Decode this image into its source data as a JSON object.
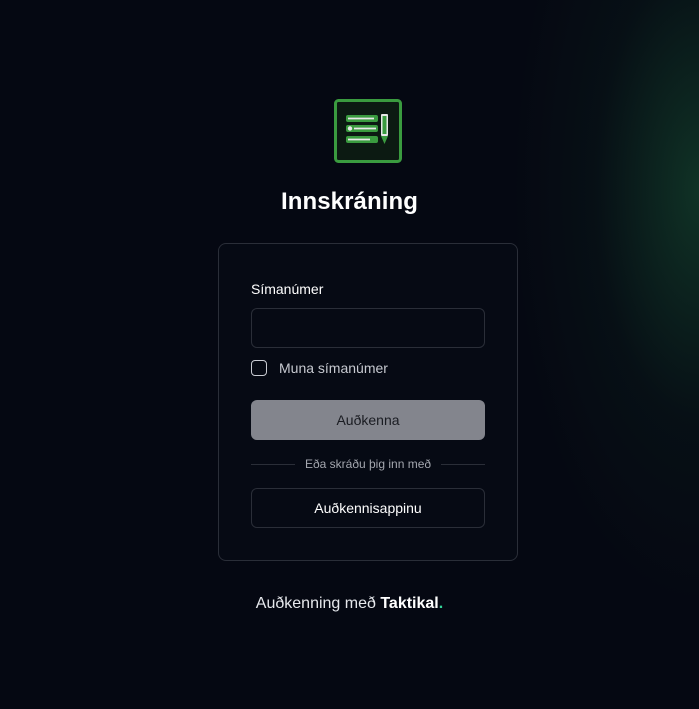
{
  "header": {
    "title": "Innskráning"
  },
  "form": {
    "phone_label": "Símanúmer",
    "phone_value": "",
    "remember_label": "Muna símanúmer",
    "remember_checked": false,
    "submit_label": "Auðkenna",
    "divider_text": "Eða skráðu þig inn með",
    "app_button_label": "Auðkennisappinu"
  },
  "footer": {
    "prefix": "Auðkenning með",
    "brand": "Taktikal",
    "brand_dot": "."
  },
  "colors": {
    "background": "#050812",
    "logo_green": "#3a9b3f",
    "accent_dot": "#34d399",
    "disabled_button": "#83858d"
  },
  "icons": {
    "logo": "document-pen-logo-icon"
  }
}
